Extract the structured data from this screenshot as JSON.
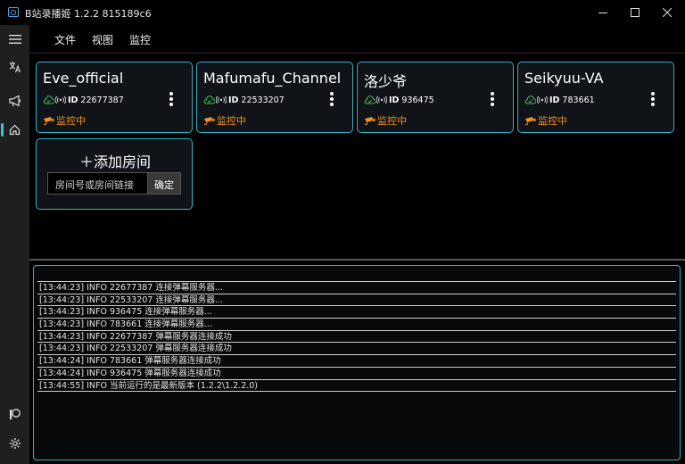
{
  "window": {
    "title": "B站录播姬 1.2.2 815189c6"
  },
  "menu": {
    "items": [
      "文件",
      "视图",
      "监控"
    ]
  },
  "rooms": [
    {
      "name": "Eve_official",
      "id_label": "ID",
      "room_id": "22677387",
      "status": "监控中"
    },
    {
      "name": "Mafumafu_Channel",
      "id_label": "ID",
      "room_id": "22533207",
      "status": "监控中"
    },
    {
      "name": "洛少爷",
      "id_label": "ID",
      "room_id": "936475",
      "status": "监控中"
    },
    {
      "name": "Seikyuu-VA",
      "id_label": "ID",
      "room_id": "783661",
      "status": "监控中"
    }
  ],
  "add_room": {
    "title": "＋添加房间",
    "placeholder": "房间号或房间链接",
    "confirm_label": "确定"
  },
  "log": [
    "[13:44:23] INFO 22677387 连接弹幕服务器...",
    "[13:44:23] INFO 22533207 连接弹幕服务器...",
    "[13:44:23] INFO 936475 连接弹幕服务器...",
    "[13:44:23] INFO 783661 连接弹幕服务器...",
    "[13:44:23] INFO 22677387 弹幕服务器连接成功",
    "[13:44:23] INFO 22533207 弹幕服务器连接成功",
    "[13:44:24] INFO 783661 弹幕服务器连接成功",
    "[13:44:24] INFO 936475 弹幕服务器连接成功",
    "[13:44:55] INFO  当前运行的是最新版本 (1.2.2\\1.2.2.0)"
  ],
  "colors": {
    "accent": "#2fb3c3",
    "status": "#f0901e",
    "online": "#3fb950"
  },
  "icons": {
    "rail": [
      "hamburger-menu-icon",
      "translate-icon",
      "megaphone-icon",
      "home-icon",
      "patreon-icon",
      "settings-gear-icon"
    ],
    "room": [
      "cloud-check-icon",
      "live-signal-icon",
      "kebab-menu-icon",
      "camera-icon"
    ]
  }
}
